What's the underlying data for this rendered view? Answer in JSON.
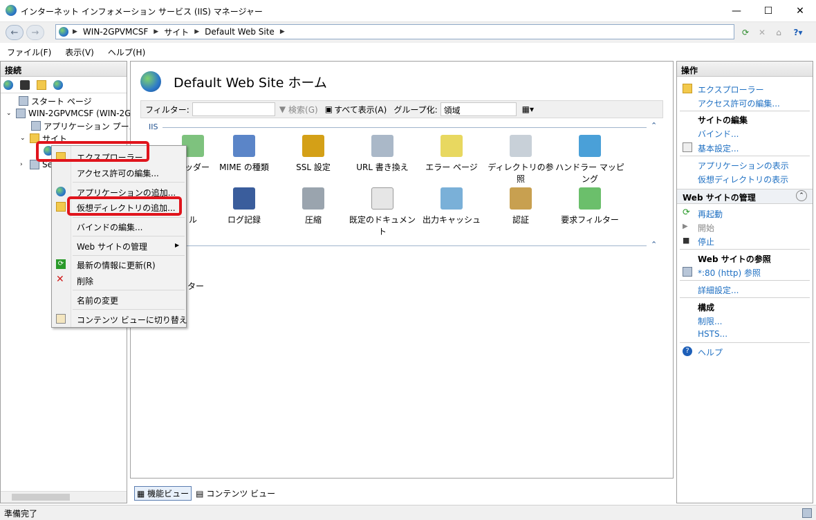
{
  "window": {
    "title": "インターネット インフォメーション サービス (IIS) マネージャー"
  },
  "address": {
    "crumbs": [
      "WIN-2GPVMCSF",
      "サイト",
      "Default Web Site"
    ]
  },
  "menu": [
    "ファイル(F)",
    "表示(V)",
    "ヘルプ(H)"
  ],
  "connections": {
    "header": "接続",
    "tree": {
      "start_page": "スタート ページ",
      "server": "WIN-2GPVMCSF (WIN-2G",
      "app_pools": "アプリケーション プール",
      "sites": "サイト",
      "other": "Se"
    }
  },
  "center": {
    "title": "Default Web Site ホーム",
    "filter_label": "フィルター:",
    "search_label": "検索(G)",
    "show_all_label": "すべて表示(A)",
    "group_label": "グループ化:",
    "group_value": "領域",
    "section_iis": "IIS",
    "features_row1": [
      "ヘッダー",
      "MIME の種類",
      "SSL 設定",
      "URL 書き換え",
      "エラー ページ",
      "ディレクトリの参照",
      "ハンドラー マッピング"
    ],
    "features_row2": [
      "ル",
      "ログ記録",
      "圧縮",
      "既定のドキュメント",
      "出力キャッシュ",
      "認証",
      "要求フィルター"
    ],
    "section2_item": "ター"
  },
  "viewtabs": {
    "features": "機能ビュー",
    "content": "コンテンツ ビュー"
  },
  "actions": {
    "header": "操作",
    "explore": "エクスプローラー",
    "edit_permissions": "アクセス許可の編集...",
    "edit_site": "サイトの編集",
    "bindings": "バインド...",
    "basic_settings": "基本設定...",
    "view_apps": "アプリケーションの表示",
    "view_vdirs": "仮想ディレクトリの表示",
    "manage_site": "Web サイトの管理",
    "restart": "再起動",
    "start": "開始",
    "stop": "停止",
    "browse_site": "Web サイトの参照",
    "browse_80": "*:80 (http) 参照",
    "advanced": "詳細設定...",
    "configure": "構成",
    "limits": "制限...",
    "hsts": "HSTS...",
    "help": "ヘルプ"
  },
  "context_menu": {
    "explore": "エクスプローラー",
    "edit_permissions": "アクセス許可の編集...",
    "add_application": "アプリケーションの追加...",
    "add_vdir": "仮想ディレクトリの追加...",
    "edit_bindings": "バインドの編集...",
    "manage_site": "Web サイトの管理",
    "refresh": "最新の情報に更新(R)",
    "delete": "削除",
    "rename": "名前の変更",
    "switch_content": "コンテンツ ビューに切り替え"
  },
  "status": {
    "text": "準備完了"
  },
  "colors": {
    "link": "#1e6fc2",
    "highlight": "#e0141c"
  }
}
